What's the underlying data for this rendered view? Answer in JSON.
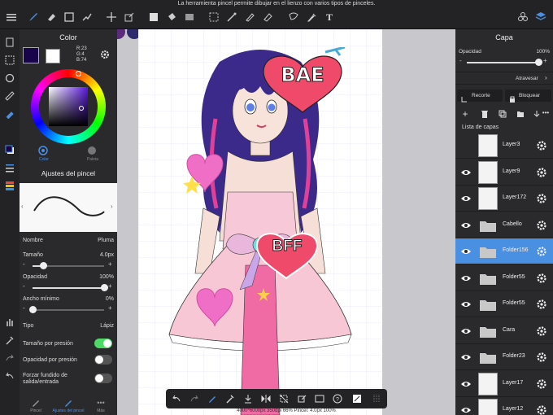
{
  "header": {
    "tip": "La herramienta pincel permite dibujar en el lienzo con varios tipos de pinceles."
  },
  "color_panel": {
    "title": "Color",
    "rgb_r": "R:23",
    "rgb_g": "G:4",
    "rgb_b": "B:74",
    "primary_color": "#17044a",
    "secondary_color": "#ffffff",
    "tab_color": "Color",
    "tab_palette": "Paleta"
  },
  "brush_panel": {
    "title": "Ajustes del pincel",
    "name_label": "Nombre",
    "name_value": "Pluma",
    "size_label": "Tamaño",
    "size_value": "4.0px",
    "size_level": 0.15,
    "opacity_label": "Opacidad",
    "opacity_value": "100%",
    "opacity_level": 1.0,
    "minwidth_label": "Ancho mínimo",
    "minwidth_value": "0%",
    "minwidth_level": 0.0,
    "type_label": "Tipo",
    "type_value": "Lápiz",
    "pressure_size_label": "Tamaño por presión",
    "pressure_size_on": true,
    "pressure_opacity_label": "Opacidad por presión",
    "pressure_opacity_on": false,
    "force_fade_label": "Forzar fundido de salida/entrada",
    "force_fade_on": false
  },
  "bottom_tabs": {
    "brush": "Pincel",
    "brush_settings": "Ajustes del pincel",
    "more": "Más"
  },
  "canvas": {
    "status": "4000*6000px 350dpi 66% Pincel: 4.0px 100%",
    "sticker_bae": "BAE",
    "sticker_bff": "BFF"
  },
  "layer_panel": {
    "title": "Capa",
    "opacity_label": "Opacidad",
    "opacity_value": "100%",
    "opacity_level": 1.0,
    "blend_mode": "Atravesar",
    "clip_label": "Recorte",
    "lock_label": "Bloquear",
    "list_label": "Lista de capas",
    "layers": [
      {
        "name": "Layer3",
        "kind": "layer",
        "visible": false,
        "selected": false
      },
      {
        "name": "Layer9",
        "kind": "layer",
        "visible": true,
        "selected": false
      },
      {
        "name": "Layer172",
        "kind": "layer",
        "visible": true,
        "selected": false
      },
      {
        "name": "Cabello",
        "kind": "folder",
        "visible": true,
        "selected": false
      },
      {
        "name": "Folder156",
        "kind": "folder",
        "visible": true,
        "selected": true
      },
      {
        "name": "Folder55",
        "kind": "folder",
        "visible": true,
        "selected": false
      },
      {
        "name": "Folder55",
        "kind": "folder",
        "visible": true,
        "selected": false
      },
      {
        "name": "Cara",
        "kind": "folder",
        "visible": true,
        "selected": false
      },
      {
        "name": "Folder23",
        "kind": "folder",
        "visible": true,
        "selected": false
      },
      {
        "name": "Layer17",
        "kind": "layer",
        "visible": true,
        "selected": false
      },
      {
        "name": "Layer12",
        "kind": "layer",
        "visible": true,
        "selected": false
      }
    ]
  },
  "colors": {
    "accent": "#4a90e2",
    "selected_layer": "#4a90e2",
    "toggle_on": "#4cd964",
    "sticker_red": "#f04a6a"
  }
}
